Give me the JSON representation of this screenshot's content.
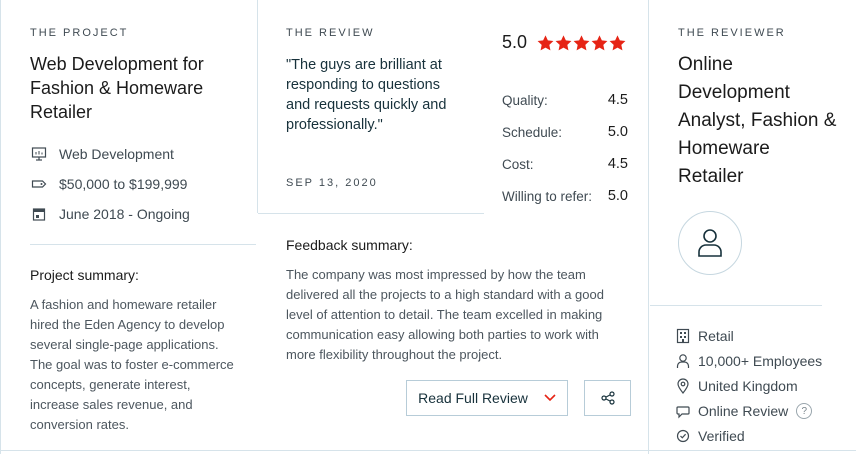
{
  "project": {
    "heading": "THE PROJECT",
    "title": "Web Development for Fashion & Homeware Retailer",
    "service": "Web Development",
    "budget": "$50,000 to $199,999",
    "dates": "June 2018 - Ongoing",
    "summary_heading": "Project summary:",
    "summary": "A fashion and homeware retailer hired the Eden Agency to develop several single-page applications. The goal was to foster e-commerce concepts, generate interest, increase sales revenue, and conversion rates."
  },
  "review": {
    "heading": "THE REVIEW",
    "quote": "\"The guys are brilliant at responding to questions and requests quickly and professionally.\"",
    "date": "SEP 13, 2020",
    "overall": "5.0",
    "stars": 5,
    "star_color": "#e62415",
    "scores": [
      {
        "label": "Quality:",
        "value": "4.5"
      },
      {
        "label": "Schedule:",
        "value": "5.0"
      },
      {
        "label": "Cost:",
        "value": "4.5"
      },
      {
        "label": "Willing to refer:",
        "value": "5.0"
      }
    ],
    "feedback_heading": "Feedback summary:",
    "feedback": "The company was most impressed by how the team delivered all the projects to a high standard with a good level of attention to detail. The team excelled in making communication easy allowing both parties to work with more flexibility throughout the project.",
    "read_button": "Read Full Review",
    "chevron_color": "#e62415"
  },
  "reviewer": {
    "heading": "THE REVIEWER",
    "title": "Online Development Analyst, Fashion & Homeware Retailer",
    "industry": "Retail",
    "size": "10,000+ Employees",
    "location": "United Kingdom",
    "review_type": "Online Review",
    "status": "Verified"
  }
}
